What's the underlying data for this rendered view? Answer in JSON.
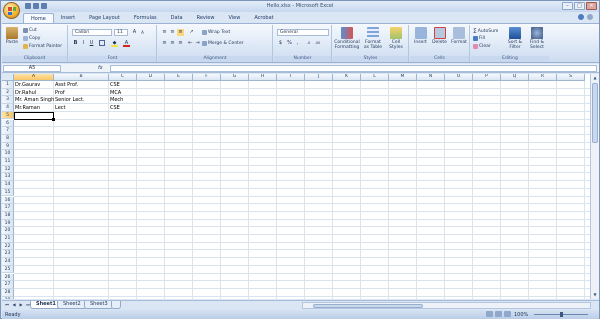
{
  "window": {
    "title": "Hello.xlsx - Microsoft Excel",
    "controls": [
      "–",
      "□",
      "✕"
    ]
  },
  "tabs": [
    "Home",
    "Insert",
    "Page Layout",
    "Formulas",
    "Data",
    "Review",
    "View",
    "Acrobat"
  ],
  "active_tab": "Home",
  "ribbon": {
    "clipboard": {
      "label": "Clipboard",
      "paste": "Paste",
      "cut": "Cut",
      "copy": "Copy",
      "format_painter": "Format Painter"
    },
    "font": {
      "label": "Font",
      "name": "Calibri",
      "size": "11",
      "bold": "B",
      "italic": "I",
      "underline": "U"
    },
    "alignment": {
      "label": "Alignment",
      "wrap_text": "Wrap Text",
      "merge_center": "Merge & Center"
    },
    "number": {
      "label": "Number",
      "format": "General",
      "currency": "$",
      "percent": "%",
      "comma": ","
    },
    "styles": {
      "label": "Styles",
      "conditional": "Conditional Formatting",
      "format_table": "Format as Table",
      "cell_styles": "Cell Styles"
    },
    "cells": {
      "label": "Cells",
      "insert": "Insert",
      "delete": "Delete",
      "format": "Format"
    },
    "editing": {
      "label": "Editing",
      "autosum": "AutoSum",
      "fill": "Fill",
      "clear": "Clear",
      "sort_filter": "Sort & Filter",
      "find_select": "Find & Select"
    }
  },
  "formula_bar": {
    "name_box": "A5",
    "fx": "fx",
    "value": ""
  },
  "columns": [
    "A",
    "B",
    "C",
    "D",
    "E",
    "F",
    "G",
    "H",
    "I",
    "J",
    "K",
    "L",
    "M",
    "N",
    "O",
    "P",
    "Q",
    "R",
    "S"
  ],
  "rows": [
    "1",
    "2",
    "3",
    "4",
    "5",
    "6",
    "7",
    "8",
    "9",
    "10",
    "11",
    "12",
    "13",
    "14",
    "15",
    "16",
    "17",
    "18",
    "19",
    "20",
    "21",
    "22",
    "23",
    "24",
    "25",
    "26",
    "27",
    "28",
    "29"
  ],
  "cells": {
    "A1": "Dr.Gaurav",
    "B1": "Asst Prof.",
    "C1": "CSE",
    "A2": "Dr.Rahul",
    "B2": "Prof",
    "C2": "MCA",
    "A3": "Mr. Aman Singh",
    "B3": "Senior Lect.",
    "C3": "Mech",
    "A4": "Mr.Raman",
    "B4": "Lect",
    "C4": "CSE"
  },
  "active_cell": "A5",
  "sheets": [
    "Sheet1",
    "Sheet2",
    "Sheet3"
  ],
  "active_sheet": "Sheet1",
  "status": {
    "mode": "Ready",
    "zoom": "100%"
  }
}
